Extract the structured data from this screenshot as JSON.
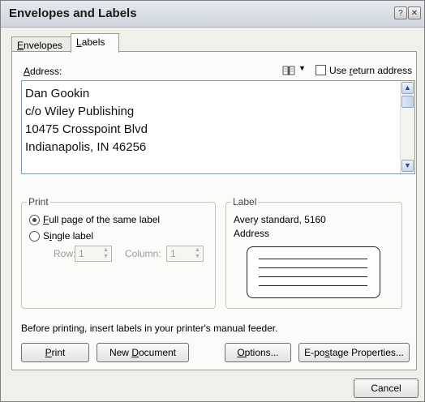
{
  "window": {
    "title": "Envelopes and Labels",
    "help_glyph": "?",
    "close_glyph": "✕"
  },
  "tabs": [
    {
      "label": "Envelopes",
      "accel": "E",
      "rest": "nvelopes",
      "selected": false
    },
    {
      "label": "Labels",
      "accel": "L",
      "rest": "abels",
      "selected": true
    }
  ],
  "address": {
    "label": "Address:",
    "label_accel": "A",
    "label_rest": "ddress:",
    "lines": [
      "Dan Gookin",
      "c/o Wiley Publishing",
      "10475 Crosspoint Blvd",
      "Indianapolis, IN 46256"
    ],
    "use_return_address": {
      "label": "Use return address",
      "pre": "Use ",
      "accel": "r",
      "rest": "eturn address",
      "checked": false
    }
  },
  "print": {
    "legend": "Print",
    "full_page": {
      "label": "Full page of the same label",
      "accel": "F",
      "rest": "ull page of the same label",
      "selected": true
    },
    "single_label": {
      "label": "Single label",
      "pre": "S",
      "accel": "i",
      "rest": "ngle label",
      "selected": false
    },
    "row": {
      "label": "Row:",
      "value": "1"
    },
    "column": {
      "label": "Column:",
      "value": "1"
    }
  },
  "label": {
    "legend": "Label",
    "product": "Avery standard, 5160",
    "type": "Address"
  },
  "feeder_note": "Before printing, insert labels in your printer's manual feeder.",
  "buttons": {
    "print": {
      "label": "Print",
      "accel": "P",
      "rest": "rint"
    },
    "new_document": {
      "label": "New Document",
      "pre": "New ",
      "accel": "D",
      "rest": "ocument"
    },
    "options": {
      "label": "Options...",
      "accel": "O",
      "rest": "ptions..."
    },
    "epostage": {
      "label": "E-postage Properties...",
      "pre": "E-po",
      "accel": "s",
      "rest": "tage Properties..."
    },
    "cancel": {
      "label": "Cancel"
    }
  }
}
